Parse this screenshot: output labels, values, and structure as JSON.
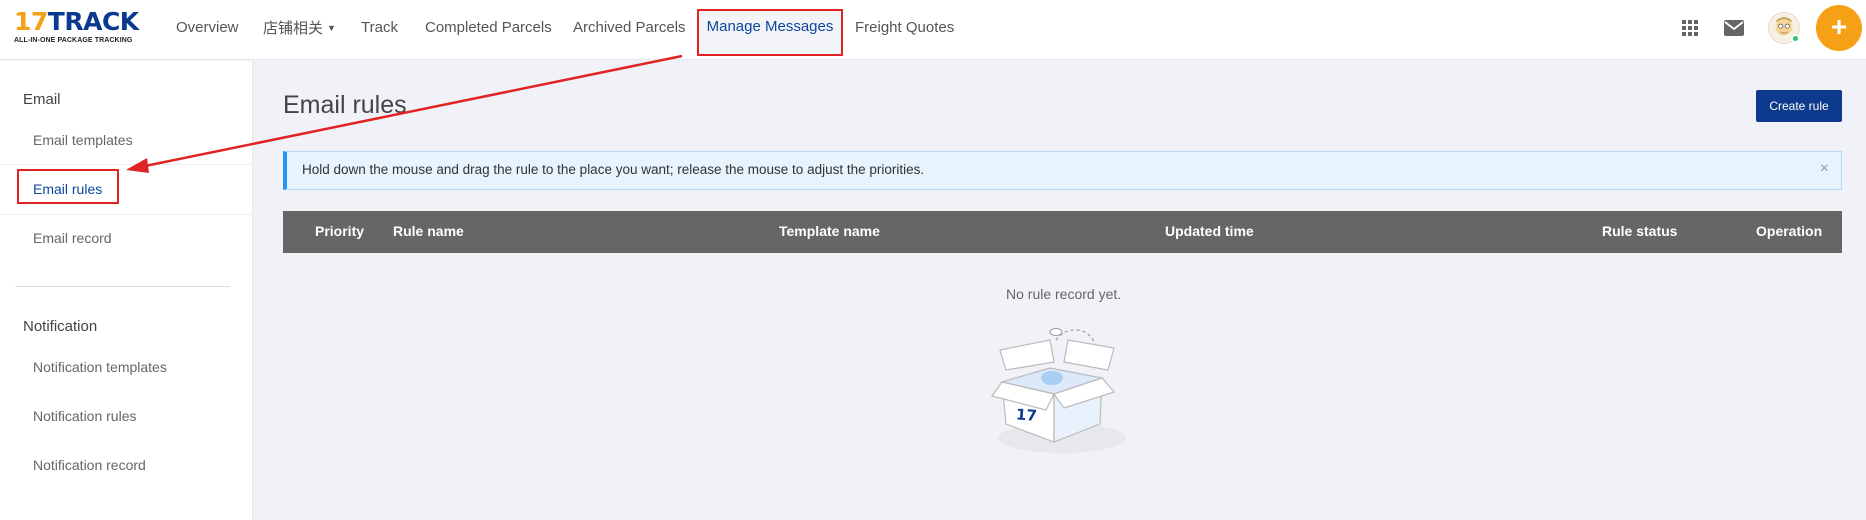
{
  "logo": {
    "number": "17",
    "brand": "TRACK",
    "tagline": "ALL-IN-ONE PACKAGE TRACKING"
  },
  "nav": {
    "overview": "Overview",
    "store": "店铺相关",
    "track": "Track",
    "completed": "Completed Parcels",
    "archived": "Archived Parcels",
    "manage_messages": "Manage Messages",
    "freight": "Freight Quotes"
  },
  "topbar_icons": [
    "apps-grid-icon",
    "mail-icon",
    "avatar",
    "plus-icon"
  ],
  "plus_label": "+",
  "sidebar": {
    "email_section": "Email",
    "email_templates": "Email templates",
    "email_rules": "Email rules",
    "email_record": "Email record",
    "notification_section": "Notification",
    "notification_templates": "Notification templates",
    "notification_rules": "Notification rules",
    "notification_record": "Notification record"
  },
  "main": {
    "title": "Email rules",
    "create_button": "Create rule",
    "info_message": "Hold down the mouse and drag the rule to the place you want; release the mouse to adjust the priorities.",
    "info_close": "×",
    "columns": [
      "Priority",
      "Rule name",
      "Template name",
      "Updated time",
      "Rule status",
      "Operation"
    ],
    "empty_text": "No rule record yet.",
    "illustration_label": "17"
  },
  "colors": {
    "accent": "#0d3a8c",
    "brand_orange": "#f5a015",
    "annotation_red": "#e02424",
    "table_header": "#666666"
  }
}
